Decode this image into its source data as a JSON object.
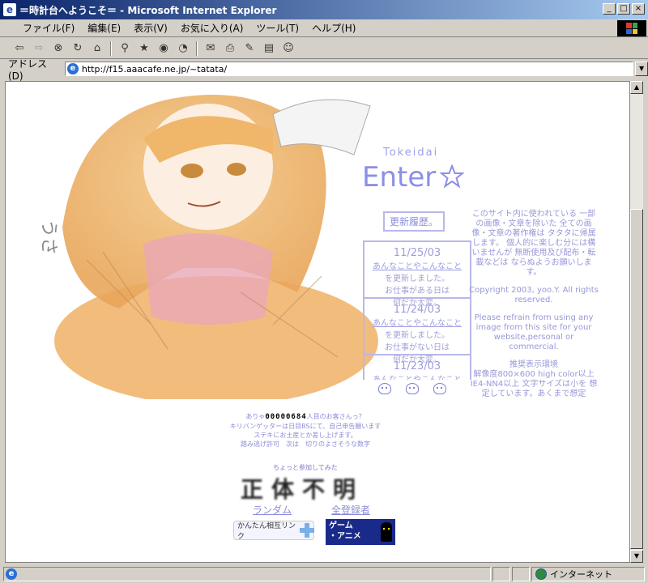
{
  "window": {
    "title": "＝時計台へようこそ＝ - Microsoft Internet Explorer",
    "controls": [
      "_",
      "□",
      "×"
    ]
  },
  "menu": [
    "ファイル(F)",
    "編集(E)",
    "表示(V)",
    "お気に入り(A)",
    "ツール(T)",
    "ヘルプ(H)"
  ],
  "address": {
    "label": "アドレス(D)",
    "url": "http://f15.aaacafe.ne.jp/~tatata/"
  },
  "page": {
    "tokeidai": "Tokeidai",
    "enter": "Enter",
    "update_history": "更新履歴。",
    "news": [
      {
        "date": "11/25/03",
        "link": "あんなことやこんなこと",
        "l2": "を更新しました。",
        "l3": "お仕事がある日は",
        "l4": "何だか大変。"
      },
      {
        "date": "11/24/03",
        "link": "あんなことやこんなこと",
        "l2": "を更新しました。",
        "l3": "お仕事がない日は",
        "l4": "何だか大変。"
      },
      {
        "date": "11/23/03",
        "link": "あんなことやこんなこと",
        "l2": "",
        "l3": "",
        "l4": ""
      }
    ],
    "notice_jp": "このサイト内に使われている 一部の画像・文章を除いた 全ての画像・文章の著作権は タタタに帰属します。 個人的に楽しむ分には構いませんが 無断使用及び配布・転載などは ならぬようお願いします。",
    "copyright": "Copyright 2003, yoo.Y. All rights reserved.",
    "notice_en": "Please refrain from using any image from this site for your website,personal or commercial.",
    "env_title": "推奨表示環境",
    "env_text": "解像度800×600 high color以上 IE4-NN4以上 文字サイズは小を 想定しています。あくまで想定",
    "counter_prefix": "ありゃ",
    "counter_value": "00000684",
    "counter_suffix": "人目のお客さんっ？",
    "counter_l2": "キリバンゲッターは日目BSにて、自己申告願います",
    "counter_l3": "ステキにお土産とか差し上げます。",
    "counter_l4": "踏み逃げ許可　次は　切りのよさそうな数字",
    "joined": "ちょっと参加してみた",
    "shotai": [
      "正",
      "体",
      "不",
      "明"
    ],
    "random": "ランダム",
    "all_list": "全登録者",
    "banner1": "かんたん相互リンク",
    "banner2_l1": "ゲーム",
    "banner2_l2": "・アニメ"
  },
  "status": {
    "zone": "インターネット"
  }
}
